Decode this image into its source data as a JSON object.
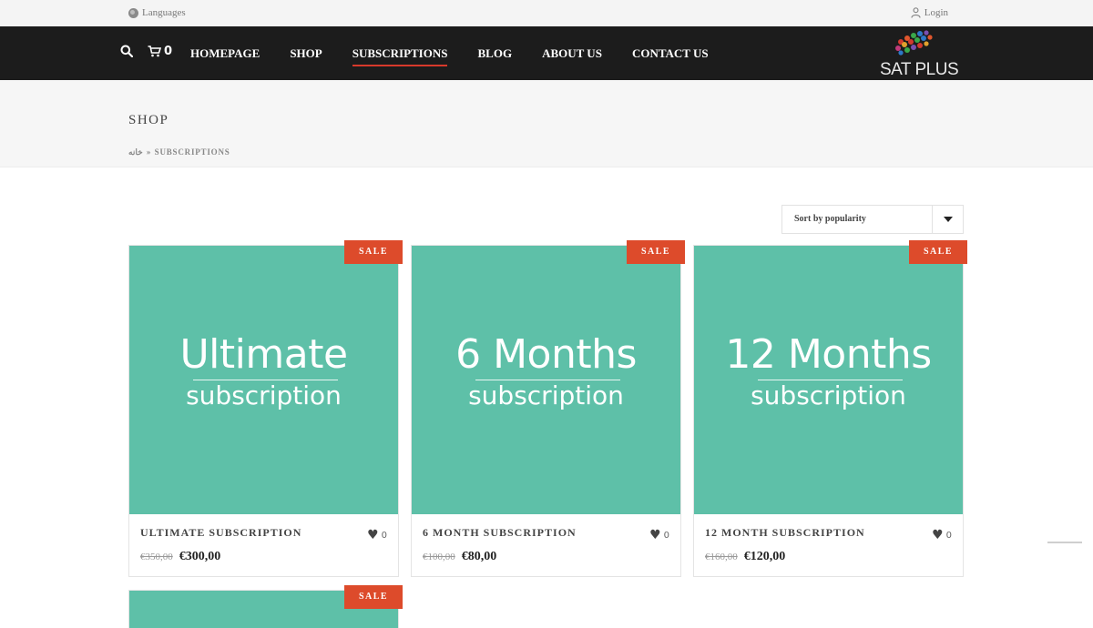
{
  "topbar": {
    "languages": "Languages",
    "login": "Login"
  },
  "nav": {
    "cart_count": "0",
    "items": [
      {
        "label": "HOMEPAGE",
        "active": false
      },
      {
        "label": "SHOP",
        "active": false
      },
      {
        "label": "SUBSCRIPTIONS",
        "active": true
      },
      {
        "label": "BLOG",
        "active": false
      },
      {
        "label": "ABOUT US",
        "active": false
      },
      {
        "label": "CONTACT US",
        "active": false
      }
    ],
    "logo_text": "SAT PLUS"
  },
  "page": {
    "title": "SHOP",
    "breadcrumb": {
      "home": "خانه",
      "separator": "»",
      "current": "SUBSCRIPTIONS"
    }
  },
  "sort": {
    "selected": "Sort by popularity"
  },
  "products": [
    {
      "badge": "SALE",
      "image_big": "Ultimate",
      "image_small": "subscription",
      "name": "ULTIMATE SUBSCRIPTION",
      "wishlist": "0",
      "old_price": "€350,00",
      "price": "€300,00"
    },
    {
      "badge": "SALE",
      "image_big": "6 Months",
      "image_small": "subscription",
      "name": "6 MONTH SUBSCRIPTION",
      "wishlist": "0",
      "old_price": "€100,00",
      "price": "€80,00"
    },
    {
      "badge": "SALE",
      "image_big": "12 Months",
      "image_small": "subscription",
      "name": "12 MONTH SUBSCRIPTION",
      "wishlist": "0",
      "old_price": "€160,00",
      "price": "€120,00"
    },
    {
      "badge": "SALE"
    }
  ],
  "colors": {
    "accent": "#dd4b2b",
    "thumb": "#5ec0a8",
    "nav_bg": "#1c1c1c",
    "active_underline": "#d8392b"
  },
  "icons": {
    "language": "globe-icon",
    "login": "user-icon",
    "search": "search-icon",
    "cart": "cart-icon",
    "wishlist": "heart-icon",
    "sort": "chevron-down-icon"
  }
}
